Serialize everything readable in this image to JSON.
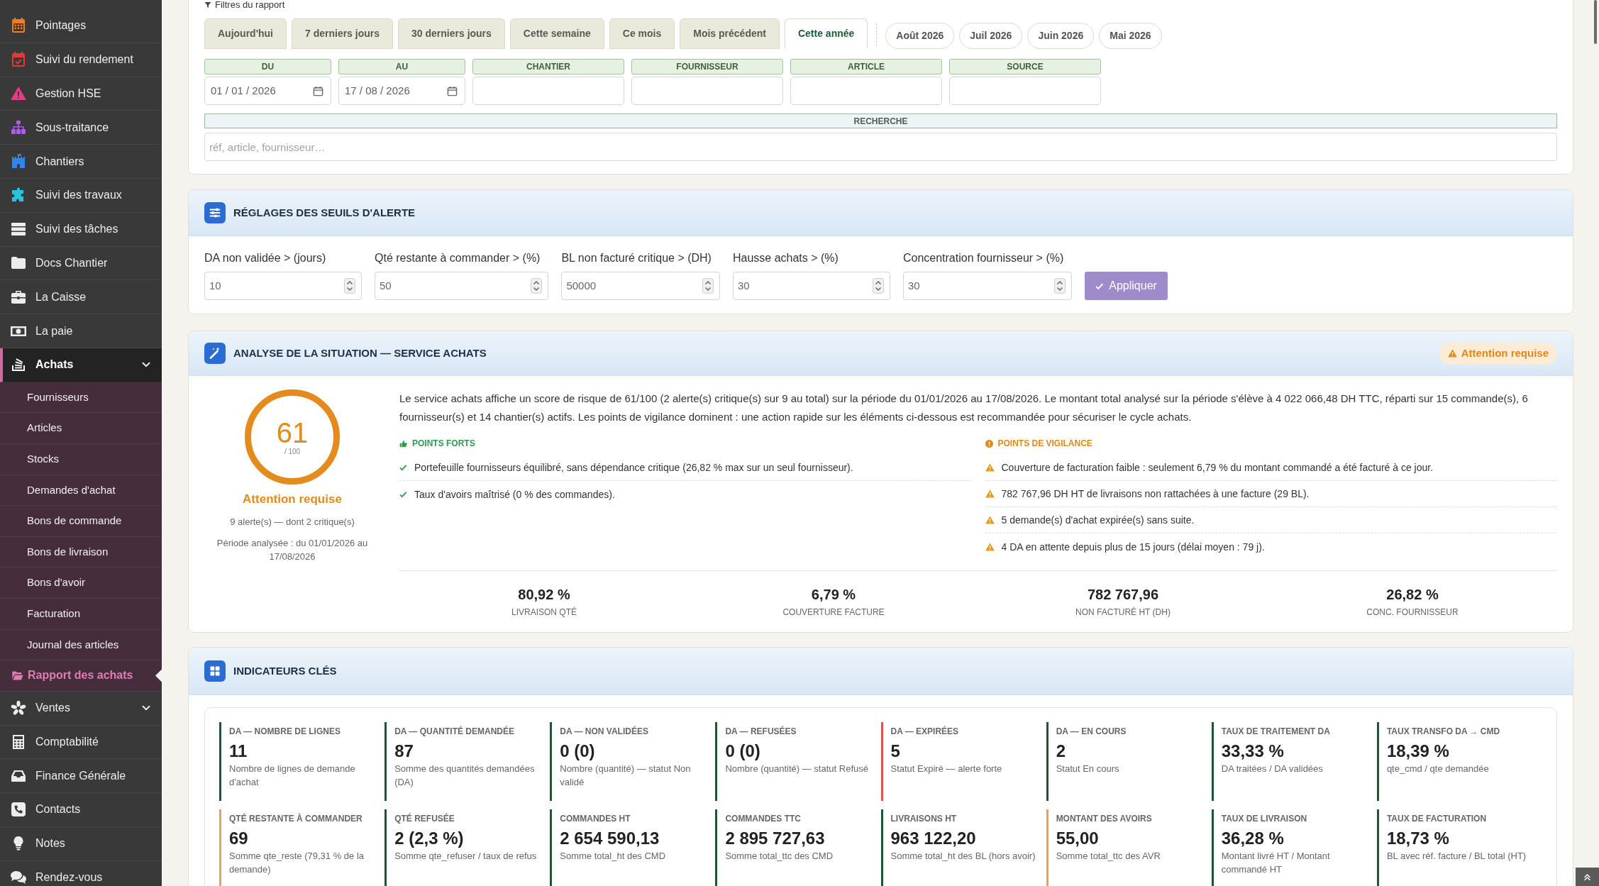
{
  "sidebar": {
    "items": [
      {
        "label": "Pointages",
        "kind": "link",
        "selected": false
      },
      {
        "label": "Suivi du rendement",
        "kind": "link",
        "selected": false
      },
      {
        "label": "Gestion HSE",
        "kind": "link",
        "selected": false
      },
      {
        "label": "Sous-traitance",
        "kind": "link",
        "selected": false
      },
      {
        "label": "Chantiers",
        "kind": "link",
        "selected": false
      },
      {
        "label": "Suivi des travaux",
        "kind": "link",
        "selected": false
      },
      {
        "label": "Suivi des tâches",
        "kind": "link",
        "selected": false
      },
      {
        "label": "Docs Chantier",
        "kind": "link",
        "selected": false
      },
      {
        "label": "La Caisse",
        "kind": "link",
        "selected": false
      },
      {
        "label": "La paie",
        "kind": "link",
        "selected": false
      },
      {
        "label": "Achats",
        "kind": "group",
        "selected": true,
        "children": [
          {
            "label": "Fournisseurs",
            "selected": false
          },
          {
            "label": "Articles",
            "selected": false
          },
          {
            "label": "Stocks",
            "selected": false
          },
          {
            "label": "Demandes d'achat",
            "selected": false
          },
          {
            "label": "Bons de commande",
            "selected": false
          },
          {
            "label": "Bons de livraison",
            "selected": false
          },
          {
            "label": "Bons d'avoir",
            "selected": false
          },
          {
            "label": "Facturation",
            "selected": false
          },
          {
            "label": "Journal des articles",
            "selected": false
          },
          {
            "label": "Rapport des achats",
            "selected": true
          }
        ]
      },
      {
        "label": "Ventes",
        "kind": "group",
        "selected": false
      },
      {
        "label": "Comptabilité",
        "kind": "link",
        "selected": false
      },
      {
        "label": "Finance Générale",
        "kind": "link",
        "selected": false
      },
      {
        "label": "Contacts",
        "kind": "link",
        "selected": false
      },
      {
        "label": "Notes",
        "kind": "link",
        "selected": false
      },
      {
        "label": "Rendez-vous",
        "kind": "link",
        "selected": false
      }
    ]
  },
  "filters": {
    "title": "Filtres du rapport",
    "tabs": [
      {
        "label": "Aujourd'hui",
        "selected": false
      },
      {
        "label": "7 derniers jours",
        "selected": false
      },
      {
        "label": "30 derniers jours",
        "selected": false
      },
      {
        "label": "Cette semaine",
        "selected": false
      },
      {
        "label": "Ce mois",
        "selected": false
      },
      {
        "label": "Mois précédent",
        "selected": false
      },
      {
        "label": "Cette année",
        "selected": true
      }
    ],
    "months": [
      {
        "label": "Août 2026",
        "selected": false
      },
      {
        "label": "Juil 2026",
        "selected": false
      },
      {
        "label": "Juin 2026",
        "selected": false
      },
      {
        "label": "Mai 2026",
        "selected": false
      }
    ],
    "fields": [
      {
        "label": "DU",
        "kind": "date",
        "value": "01 / 01 / 2026"
      },
      {
        "label": "AU",
        "kind": "date",
        "value": "17 / 08 / 2026"
      },
      {
        "label": "CHANTIER",
        "kind": "text"
      },
      {
        "label": "FOURNISSEUR",
        "kind": "text"
      },
      {
        "label": "ARTICLE",
        "kind": "text"
      },
      {
        "label": "SOURCE",
        "kind": "text"
      }
    ],
    "search": {
      "label": "RECHERCHE",
      "placeholder": "réf, article, fournisseur…"
    }
  },
  "thresholds": {
    "title": "RÉGLAGES DES SEUILS D'ALERTE",
    "fields": [
      {
        "label": "DA non validée > (jours)",
        "value": "10"
      },
      {
        "label": "Qté restante à commander > (%)",
        "value": "50"
      },
      {
        "label": "BL non facturé critique > (DH)",
        "value": "50000"
      },
      {
        "label": "Hausse achats > (%)",
        "value": "30"
      },
      {
        "label": "Concentration fournisseur > (%)",
        "value": "30"
      }
    ],
    "apply_button": "Appliquer"
  },
  "analysis": {
    "title": "ANALYSE DE LA SITUATION — SERVICE ACHATS",
    "badge": "Attention requise",
    "score": {
      "value": "61",
      "scale": "/ 100",
      "status": "Attention requise",
      "alerts": "9 alerte(s) — dont 2 critique(s)",
      "period": "Période analysée : du 01/01/2026 au 17/08/2026"
    },
    "summary": "Le service achats affiche un score de risque de 61/100 (2 alerte(s) critique(s) sur 9 au total) sur la période du 01/01/2026 au 17/08/2026. Le montant total analysé sur la période s'élève à 4 022 066,48 DH TTC, réparti sur 15 commande(s), 6 fournisseur(s) et 14 chantier(s) actifs. Les points de vigilance dominent : une action rapide sur les éléments ci-dessous est recommandée pour sécuriser le cycle achats.",
    "strengths": {
      "title": "POINTS FORTS",
      "items": [
        "Portefeuille fournisseurs équilibré, sans dépendance critique (26,82 % max sur un seul fournisseur).",
        "Taux d'avoirs maîtrisé (0 % des commandes)."
      ]
    },
    "warnings": {
      "title": "POINTS DE VIGILANCE",
      "items": [
        "Couverture de facturation faible : seulement 6,79 % du montant commandé a été facturé à ce jour.",
        "782 767,96 DH HT de livraisons non rattachées à une facture (29 BL).",
        "5 demande(s) d'achat expirée(s) sans suite.",
        "4 DA en attente depuis plus de 15 jours (délai moyen : 79 j)."
      ]
    },
    "stats": [
      {
        "value": "80,92 %",
        "label": "LIVRAISON QTÉ"
      },
      {
        "value": "6,79 %",
        "label": "COUVERTURE FACTURE"
      },
      {
        "value": "782 767,96",
        "label": "NON FACTURÉ HT (DH)"
      },
      {
        "value": "26,82 %",
        "label": "CONC. FOURNISSEUR"
      }
    ]
  },
  "indicators": {
    "title": "INDICATEURS CLÉS",
    "items": [
      {
        "label": "DA — NOMBRE DE LIGNES",
        "value": "11",
        "description": "Nombre de lignes de demande d'achat",
        "color": "#1e5631"
      },
      {
        "label": "DA — QUANTITÉ DEMANDÉE",
        "value": "87",
        "description": "Somme des quantités demandées (DA)",
        "color": "#1e5631"
      },
      {
        "label": "DA — NON VALIDÉES",
        "value": "0 (0)",
        "description": "Nombre (quantité) — statut Non validé",
        "color": "#1e5631"
      },
      {
        "label": "DA — REFUSÉES",
        "value": "0 (0)",
        "description": "Nombre (quantité) — statut Refusé",
        "color": "#1e5631"
      },
      {
        "label": "DA — EXPIRÉES",
        "value": "5",
        "description": "Statut Expiré — alerte forte",
        "color": "#d9534f"
      },
      {
        "label": "DA — EN COURS",
        "value": "2",
        "description": "Statut En cours",
        "color": "#1e5631"
      },
      {
        "label": "TAUX DE TRAITEMENT DA",
        "value": "33,33 %",
        "description": "DA traitées / DA validées",
        "color": "#1e5631"
      },
      {
        "label": "TAUX TRANSFO DA → CMD",
        "value": "18,39 %",
        "description": "qte_cmd / qte demandée",
        "color": "#1e5631"
      },
      {
        "label": "QTÉ RESTANTE À COMMANDER",
        "value": "69",
        "description": "Somme qte_reste (79,31 % de la demande)",
        "color": "#f0a04b"
      },
      {
        "label": "QTÉ REFUSÉE",
        "value": "2 (2,3 %)",
        "description": "Somme qte_refuser / taux de refus",
        "color": "#1e5631"
      },
      {
        "label": "COMMANDES HT",
        "value": "2 654 590,13",
        "description": "Somme total_ht des CMD",
        "color": "#1e5631"
      },
      {
        "label": "COMMANDES TTC",
        "value": "2 895 727,63",
        "description": "Somme total_ttc des CMD",
        "color": "#1e5631"
      },
      {
        "label": "LIVRAISONS HT",
        "value": "963 122,20",
        "description": "Somme total_ht des BL (hors avoir)",
        "color": "#1e5631"
      },
      {
        "label": "MONTANT DES AVOIRS",
        "value": "55,00",
        "description": "Somme total_ttc des AVR",
        "color": "#f0a04b"
      },
      {
        "label": "TAUX DE LIVRAISON",
        "value": "36,28 %",
        "description": "Montant livré HT / Montant commandé HT",
        "color": "#1e5631"
      },
      {
        "label": "TAUX DE FACTURATION",
        "value": "18,73 %",
        "description": "BL avec réf. facture / BL total (HT)",
        "color": "#1e5631"
      }
    ]
  }
}
